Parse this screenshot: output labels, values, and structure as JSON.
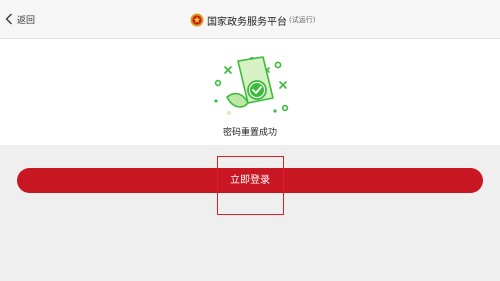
{
  "header": {
    "back_label": "返回",
    "title": "国家政务服务平台",
    "title_suffix": "(试运行)"
  },
  "result": {
    "message": "密码重置成功"
  },
  "actions": {
    "login_label": "立即登录"
  },
  "colors": {
    "primary_red": "#c81623",
    "success_green": "#3dbb3d",
    "light_green": "#d6f2c4"
  },
  "icons": {
    "back": "chevron-left-icon",
    "emblem": "national-emblem-icon",
    "illustration": "document-check-icon"
  }
}
